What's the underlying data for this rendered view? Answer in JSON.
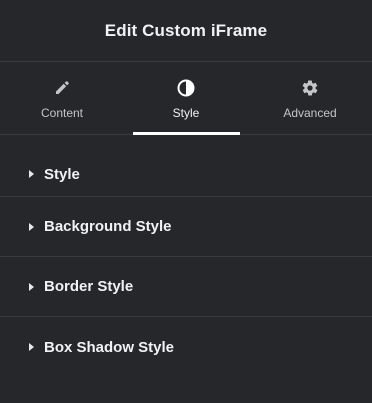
{
  "header": {
    "title": "Edit Custom iFrame"
  },
  "tabs": [
    {
      "label": "Content",
      "icon": "pencil-icon",
      "active": false
    },
    {
      "label": "Style",
      "icon": "half-circle-icon",
      "active": true
    },
    {
      "label": "Advanced",
      "icon": "gear-icon",
      "active": false
    }
  ],
  "sections": [
    {
      "label": "Style"
    },
    {
      "label": "Background Style"
    },
    {
      "label": "Border Style"
    },
    {
      "label": "Box Shadow Style"
    }
  ],
  "colors": {
    "background": "#26272b",
    "divider": "#3a3c40",
    "text": "#f1f2f3",
    "muted_text": "#c2c5c9",
    "active_indicator": "#ffffff"
  }
}
